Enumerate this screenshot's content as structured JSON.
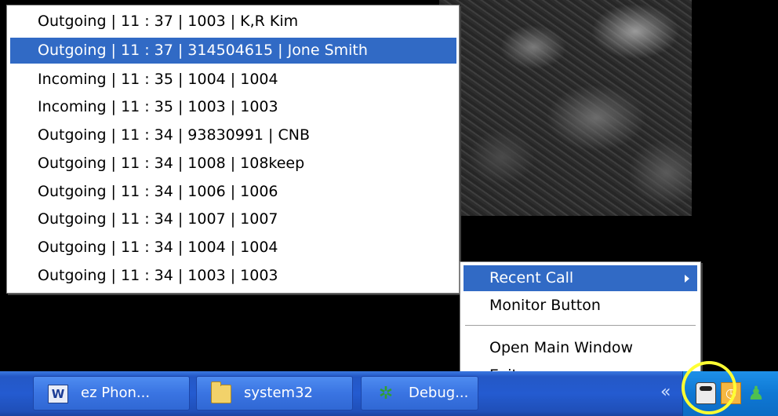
{
  "recent_calls": [
    {
      "text": "Outgoing | 11 : 37 | 1003 | K,R Kim",
      "selected": false
    },
    {
      "text": "Outgoing | 11 : 37 | 314504615 | Jone Smith",
      "selected": true
    },
    {
      "text": "Incoming | 11 : 35 | 1004 | 1004",
      "selected": false
    },
    {
      "text": "Incoming | 11 : 35 | 1003 | 1003",
      "selected": false
    },
    {
      "text": "Outgoing | 11 : 34 | 93830991 | CNB",
      "selected": false
    },
    {
      "text": "Outgoing | 11 : 34 | 1008 | 108keep",
      "selected": false
    },
    {
      "text": "Outgoing | 11 : 34 | 1006 | 1006",
      "selected": false
    },
    {
      "text": "Outgoing | 11 : 34 | 1007 | 1007",
      "selected": false
    },
    {
      "text": "Outgoing | 11 : 34 | 1004 | 1004",
      "selected": false
    },
    {
      "text": "Outgoing | 11 : 34 | 1003 | 1003",
      "selected": false
    }
  ],
  "context_menu": {
    "recent_call": "Recent Call",
    "monitor_button": "Monitor Button",
    "open_main_window": "Open Main Window",
    "exit": "Exit"
  },
  "taskbar": {
    "buttons": [
      {
        "label": "ez Phon...",
        "icon": "word-document-icon"
      },
      {
        "label": "system32",
        "icon": "folder-icon"
      },
      {
        "label": "Debug...",
        "icon": "debug-bug-icon"
      }
    ],
    "tray_icons": [
      "phone-icon",
      "clock-icon",
      "user-icon"
    ]
  },
  "colors": {
    "selection": "#316ac5",
    "taskbar": "#245bd0",
    "tray": "#0e78d4",
    "highlight_ring": "#ffff33"
  }
}
